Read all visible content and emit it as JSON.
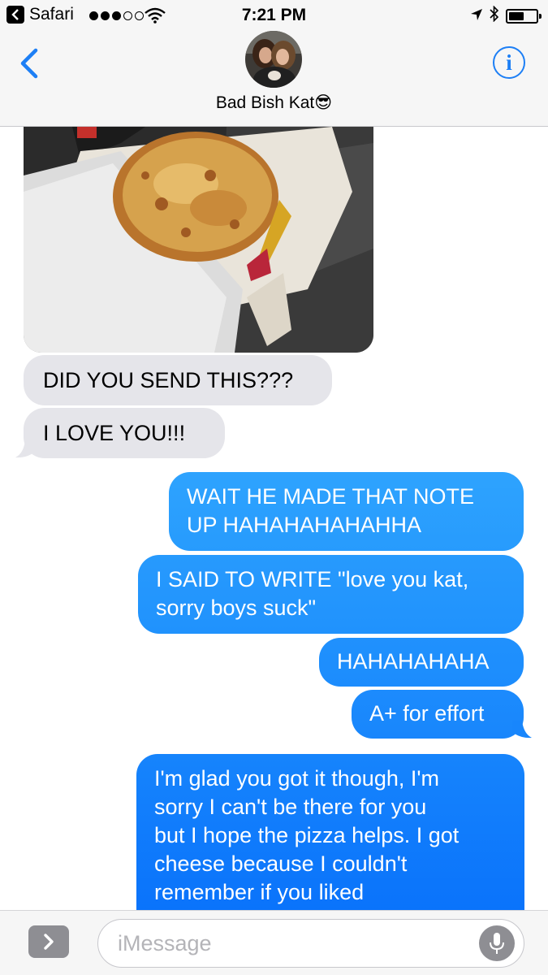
{
  "status_bar": {
    "back_app": "Safari",
    "time": "7:21 PM",
    "signal_bars": 3,
    "signal_total": 5,
    "battery_level": 0.55
  },
  "header": {
    "contact_name": "Bad Bish Kat😎",
    "info_label": "i"
  },
  "conversation": {
    "received": [
      {
        "text": "DID YOU SEND THIS???"
      },
      {
        "text": "I LOVE YOU!!!"
      }
    ],
    "sent": [
      {
        "lines": [
          "WAIT HE MADE THAT NOTE",
          "UP HAHAHAHAHAHHA"
        ]
      },
      {
        "lines": [
          "I SAID TO WRITE \"love you kat,",
          "sorry boys suck\""
        ]
      },
      {
        "lines": [
          "HAHAHAHAHA"
        ]
      },
      {
        "lines": [
          "A+ for effort"
        ]
      },
      {
        "lines": [
          "I'm glad you got it though, I'm",
          "sorry I can't be there for you",
          "but I hope the pizza helps. I got",
          "cheese because I couldn't",
          "remember if you liked"
        ]
      }
    ]
  },
  "composer": {
    "placeholder": "iMessage"
  },
  "colors": {
    "accent": "#1d7ff5",
    "received_bubble": "#e5e5ea",
    "sent_gradient_top": "#2fa5fe",
    "sent_gradient_bottom": "#0770fb"
  },
  "icons": {
    "back": "chevron-left-icon",
    "info": "info-icon",
    "apps": "chevron-right-icon",
    "mic": "microphone-icon",
    "wifi": "wifi-icon",
    "location": "location-arrow-icon",
    "bluetooth": "bluetooth-icon",
    "battery": "battery-icon"
  }
}
